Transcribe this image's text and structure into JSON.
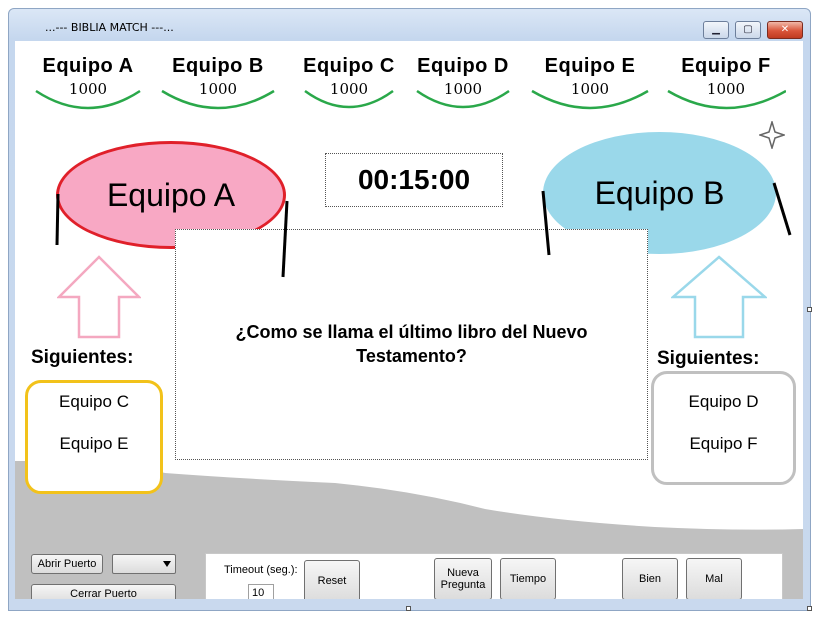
{
  "window": {
    "title": "...--- BIBLIA MATCH ---..."
  },
  "caption_buttons": {
    "minimize": "▁",
    "maximize": "▢",
    "close": "✕"
  },
  "teams": [
    {
      "name": "Equipo A",
      "score": "1000"
    },
    {
      "name": "Equipo B",
      "score": "1000"
    },
    {
      "name": "Equipo C",
      "score": "1000"
    },
    {
      "name": "Equipo D",
      "score": "1000"
    },
    {
      "name": "Equipo E",
      "score": "1000"
    },
    {
      "name": "Equipo F",
      "score": "1000"
    }
  ],
  "active": {
    "left": "Equipo A",
    "right": "Equipo B"
  },
  "timer": "00:15:00",
  "question": "¿Como se llama el último libro del Nuevo Testamento?",
  "next_left": {
    "label": "Siguientes:",
    "items": [
      "Equipo C",
      "Equipo E"
    ]
  },
  "next_right": {
    "label": "Siguientes:",
    "items": [
      "Equipo D",
      "Equipo F"
    ]
  },
  "controls": {
    "open_port": "Abrir Puerto",
    "close_port": "Cerrar Puerto",
    "port_select": "",
    "timeout_label": "Timeout (seg.):",
    "timeout_value": "10",
    "reset": "Reset",
    "new_question_line1": "Nueva",
    "new_question_line2": "Pregunta",
    "time": "Tiempo",
    "good": "Bien",
    "bad": "Mal"
  },
  "colors": {
    "team_a_fill": "#f8a8c4",
    "team_a_border": "#e0202a",
    "team_b_fill": "#9ad8ea",
    "score_arc": "#2aa84a",
    "next_left_border": "#f2c21a",
    "next_right_border": "#c0c0c0",
    "ground": "#c0c0c0"
  },
  "icons": {
    "sparkle": "sparkle-icon",
    "dropdown": "chevron-down-icon"
  }
}
